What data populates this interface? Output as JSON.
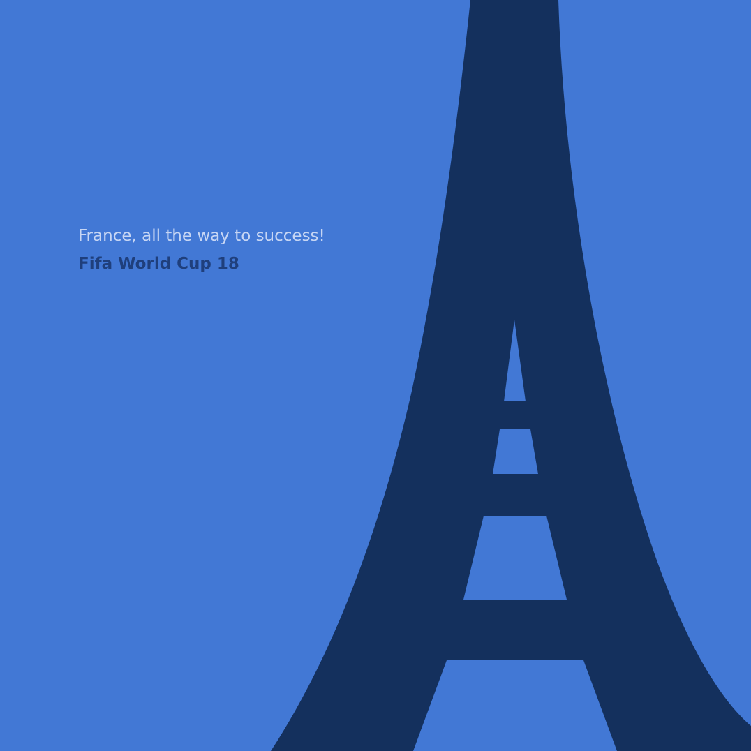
{
  "poster": {
    "tagline": "France, all the way to success!",
    "event_title": "Fifa World Cup 18",
    "illustration": "eiffel-tower-silhouette"
  },
  "colors": {
    "background": "#4278d5",
    "tower": "#14305d",
    "tagline_text": "#c7d6f4",
    "title_text": "#1f3f7c"
  }
}
